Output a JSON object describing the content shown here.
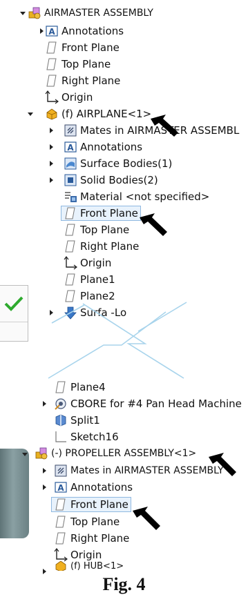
{
  "tree": {
    "assembly": "AIRMASTER ASSEMBLY",
    "a_annotations": "Annotations",
    "a_front": "Front Plane",
    "a_top": "Top Plane",
    "a_right": "Right Plane",
    "a_origin": "Origin",
    "airplane": "(f) AIRPLANE<1>",
    "ap_mates": "Mates in AIRMASTER ASSEMBL",
    "ap_annotations": "Annotations",
    "ap_surface": "Surface Bodies(1)",
    "ap_solid": "Solid Bodies(2)",
    "ap_material": "Material <not specified>",
    "ap_front": "Front Plane",
    "ap_top": "Top Plane",
    "ap_right": "Right Plane",
    "ap_origin": "Origin",
    "ap_plane1": "Plane1",
    "ap_plane2": "Plane2",
    "ap_surface_loft": "Surfa  -Lo",
    "ap_plane4": "Plane4",
    "ap_cbore": "CBORE for #4 Pan Head Machine",
    "ap_split": "Split1",
    "ap_sketch": "Sketch16",
    "propeller": "(-) PROPELLER ASSEMBLY<1>",
    "pr_mates": "Mates in AIRMASTER ASSEMBLY",
    "pr_annotations": "Annotations",
    "pr_front": "Front Plane",
    "pr_top": "Top Plane",
    "pr_right": "Right Plane",
    "pr_origin": "Origin",
    "pr_hub": "(f) HUB<1>"
  },
  "caption": "Fig. 4",
  "colors": {
    "highlight_border": "#8fb8e0",
    "highlight_bg": "#e8f2fc",
    "break_line": "#a8d4ec",
    "confirm_check": "#2eaa2e"
  },
  "icons": [
    "assembly-icon",
    "part-icon",
    "annotations-icon",
    "plane-icon",
    "origin-icon",
    "mates-icon",
    "surface-bodies-icon",
    "solid-bodies-icon",
    "material-icon",
    "surface-loft-icon",
    "hole-wizard-icon",
    "split-icon",
    "sketch-icon",
    "arrow-pointer"
  ]
}
